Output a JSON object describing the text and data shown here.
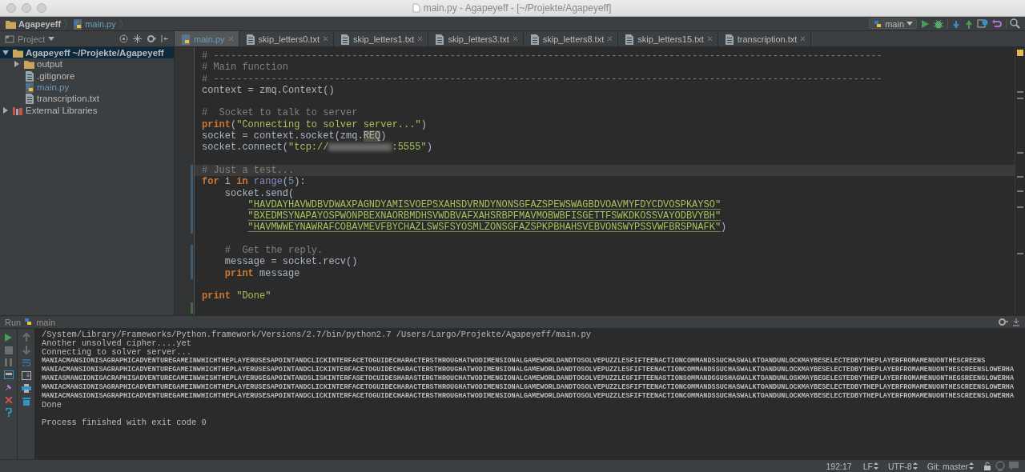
{
  "window": {
    "title": "main.py - Agapeyeff - [~/Projekte/Agapeyeff]"
  },
  "breadcrumbs": [
    {
      "label": "Agapeyeff",
      "kind": "folder"
    },
    {
      "label": "main.py",
      "kind": "python"
    }
  ],
  "toolbar": {
    "run_config": "main"
  },
  "project": {
    "title": "Project",
    "tree": [
      {
        "label": "Agapeyeff",
        "path": "~/Projekte/Agapeyeff",
        "kind": "folder",
        "selected": true,
        "expanded": true,
        "children": [
          {
            "label": "output",
            "kind": "folder",
            "selected": false,
            "expanded": false
          },
          {
            "label": ".gitignore",
            "kind": "file",
            "selected": false,
            "modified": false
          },
          {
            "label": "main.py",
            "kind": "python",
            "selected": false,
            "modified": true
          },
          {
            "label": "transcription.txt",
            "kind": "file",
            "selected": false,
            "modified": false
          }
        ]
      },
      {
        "label": "External Libraries",
        "kind": "library",
        "selected": false,
        "expanded": false
      }
    ]
  },
  "tabs": [
    {
      "label": "main.py",
      "kind": "python",
      "selected": true
    },
    {
      "label": "skip_letters0.txt",
      "kind": "file",
      "selected": false
    },
    {
      "label": "skip_letters1.txt",
      "kind": "file",
      "selected": false
    },
    {
      "label": "skip_letters3.txt",
      "kind": "file",
      "selected": false
    },
    {
      "label": "skip_letters8.txt",
      "kind": "file",
      "selected": false
    },
    {
      "label": "skip_letters15.txt",
      "kind": "file",
      "selected": false
    },
    {
      "label": "transcription.txt",
      "kind": "file",
      "selected": false
    }
  ],
  "code": [
    {
      "current": false,
      "tokens": [
        {
          "kind": "comment",
          "text": "# --------------------------------------------------------------------------------------------------------------------"
        }
      ]
    },
    {
      "current": false,
      "tokens": [
        {
          "kind": "comment",
          "text": "# Main function"
        }
      ]
    },
    {
      "current": false,
      "tokens": [
        {
          "kind": "comment",
          "text": "# --------------------------------------------------------------------------------------------------------------------"
        }
      ]
    },
    {
      "current": false,
      "tokens": [
        {
          "kind": "plain",
          "text": "context = zmq.Context()"
        }
      ]
    },
    {
      "current": false
    },
    {
      "current": false,
      "tokens": [
        {
          "kind": "comment",
          "text": "#  Socket to talk to server"
        }
      ]
    },
    {
      "current": false,
      "tokens": [
        {
          "kind": "keyword",
          "text": "print"
        },
        {
          "kind": "plain",
          "text": "("
        },
        {
          "kind": "string",
          "text": "\"Connecting to solver server...\""
        },
        {
          "kind": "plain",
          "text": ")"
        }
      ]
    },
    {
      "current": false,
      "tokens": [
        {
          "kind": "plain",
          "text": "socket = context.socket(zmq."
        },
        {
          "kind": "plain",
          "text": "REQ",
          "highlighted": true
        },
        {
          "kind": "plain",
          "text": ")"
        }
      ]
    },
    {
      "current": false,
      "tokens": [
        {
          "kind": "plain",
          "text": "socket.connect("
        },
        {
          "kind": "string",
          "text": "\"tcp://"
        },
        {
          "kind": "redacted"
        },
        {
          "kind": "string",
          "text": ":5555\""
        },
        {
          "kind": "plain",
          "text": ")"
        }
      ]
    },
    {
      "current": false
    },
    {
      "current": true,
      "modified": true,
      "tokens": [
        {
          "kind": "comment",
          "text": "# Just a test..."
        }
      ]
    },
    {
      "current": false,
      "modified": true,
      "tokens": [
        {
          "kind": "keyword",
          "text": "for"
        },
        {
          "kind": "plain",
          "text": " i "
        },
        {
          "kind": "keyword",
          "text": "in"
        },
        {
          "kind": "builtin",
          "text": " range"
        },
        {
          "kind": "plain",
          "text": "("
        },
        {
          "kind": "number",
          "text": "5"
        },
        {
          "kind": "plain",
          "text": "):"
        }
      ]
    },
    {
      "current": false,
      "modified": true,
      "tokens": [
        {
          "kind": "plain",
          "text": "    socket.send("
        }
      ]
    },
    {
      "current": false,
      "modified": true,
      "tokens": [
        {
          "kind": "string",
          "text": "        \"HAVDAYHAVWDBVDWAXPAGNDYAMISVOEPSXAHSDVRNDYNONSGFAZSPEWSWAGBDVOAVMYFDYCDVOSPKAYSO\"",
          "underlined": true
        }
      ]
    },
    {
      "current": false,
      "modified": true,
      "tokens": [
        {
          "kind": "string",
          "text": "        \"BXEDMSYNAPAYOSPWONPBEXNAORBMDHSVWDBVAFXAHSRBPFMAVMOBWBFISGETTFSWKDKOSSVAYODBVYBH\"",
          "underlined": true
        }
      ]
    },
    {
      "current": false,
      "modified": true,
      "tokens": [
        {
          "kind": "string",
          "text": "        \"HAVMWWEYNAWRAFCOBAVMEVFBYCHAZLSWSFSYOSMLZONSGFAZSPKPBHAHSVEBVONSWYPSSVWFBRSPNAFK\"",
          "underlined": true
        },
        {
          "kind": "plain",
          "text": ")"
        }
      ]
    },
    {
      "current": false
    },
    {
      "current": false,
      "modified": true,
      "tokens": [
        {
          "kind": "comment",
          "text": "    #  Get the reply."
        }
      ]
    },
    {
      "current": false,
      "modified": true,
      "tokens": [
        {
          "kind": "plain",
          "text": "    message = socket.recv()"
        }
      ]
    },
    {
      "current": false,
      "modified": true,
      "tokens": [
        {
          "kind": "keyword",
          "text": "    print"
        },
        {
          "kind": "plain",
          "text": " message"
        }
      ]
    },
    {
      "current": false
    },
    {
      "current": false,
      "tokens": [
        {
          "kind": "keyword",
          "text": "print"
        },
        {
          "kind": "string",
          "text": " \"Done\""
        }
      ]
    },
    {
      "current": false,
      "added": true
    }
  ],
  "run": {
    "title": "Run",
    "config": "main",
    "lines": [
      {
        "kind": "normal",
        "text": "/System/Library/Frameworks/Python.framework/Versions/2.7/bin/python2.7 /Users/Largo/Projekte/Agapeyeff/main.py"
      },
      {
        "kind": "normal",
        "text": "Another unsolved cipher....yet"
      },
      {
        "kind": "normal",
        "text": "Connecting to solver server..."
      },
      {
        "kind": "compressed",
        "text": "MANIACMANSIONISAGRAPHICADVENTUREGAMEINWHICHTHEPLAYERUSESAPOINTANDCLICKINTERFACETOGUIDECHARACTERSTHROUGHATWODIMENSIONALGAMEWORLDANDTOSOLVEPUZZLESFIFTEENACTIONCOMMANDSSUCHASWALKTOANDUNLOCKMAYBESELECTEDBYTHEPLAYERFROMAMENUONTHESCREENS"
      },
      {
        "kind": "compressed",
        "text": "MANIACMANSIONISAGRAPHICADVENTUREGAMEINWHICHTHEPLAYERUSESAPOINTANDCLICKINTERFACETOGUIDECHARACTERSTHROUGHATWODIMENSIONALGAMEWORLDANDTOSOLVEPUZZLESFIFTEENACTIONCOMMANDSSUCHASWALKTOANDUNLOCKMAYBESELECTEDBYTHEPLAYERFROMAMENUONTHESCREENSLOWERHA"
      },
      {
        "kind": "compressed",
        "text": "MANIASMANGIONIGACRAPHISADVENTURECAMEINWHISHTHEPLAYERUGEGAPOINTANDSLISKINTERFASETOCUIDESHARASTERGTHROUCHATWODIMENGIONALCAMEWORLDANDTOGOLVEPUZZLEGFIFTEENASTIONSOMMANDGGUSHAGWALKTOANDUNLOSKMAYBEGELESTEDBYTHEPLAYERFROMAMENUONTHEGSREENGLOWERHA"
      },
      {
        "kind": "compressed",
        "text": "MANIACMANSIONISAGRAPHICADVENTUREGAMEINWHICHTHEPLAYERUSESAPOINTANDCLICKINTERFACETOGUIDECHARACTERSTHROUGHATWODIMENSIONALGAMEWORLDANDTOSOLVEPUZZLESFIFTEENACTIONCOMMANDSSUCHASWALKTOANDUNLOCKMAYBESELECTEDBYTHEPLAYERFROMAMENUONTHESCREENSLOWERHA"
      },
      {
        "kind": "compressed",
        "text": "MANIACMANSIONISAGRAPHICADVENTUREGAMEINWHICHTHEPLAYERUSESAPOINTANDCLICKINTERFACETOGUIDECHARACTERSTHROUGHATWODIMENSIONALGAMEWORLDANDTOSOLVEPUZZLESFIFTEENACTIONCOMMANDSSUCHASWALKTOANDUNLOCKMAYBESELECTEDBYTHEPLAYERFROMAMENUONTHESCREENSLOWERHA"
      },
      {
        "kind": "normal",
        "text": "Done"
      },
      {
        "kind": "blank"
      },
      {
        "kind": "normal",
        "text": "Process finished with exit code 0"
      }
    ]
  },
  "status_bar": {
    "position": "192:17",
    "line_separator": "LF",
    "encoding": "UTF-8",
    "vcs": "Git: master"
  }
}
